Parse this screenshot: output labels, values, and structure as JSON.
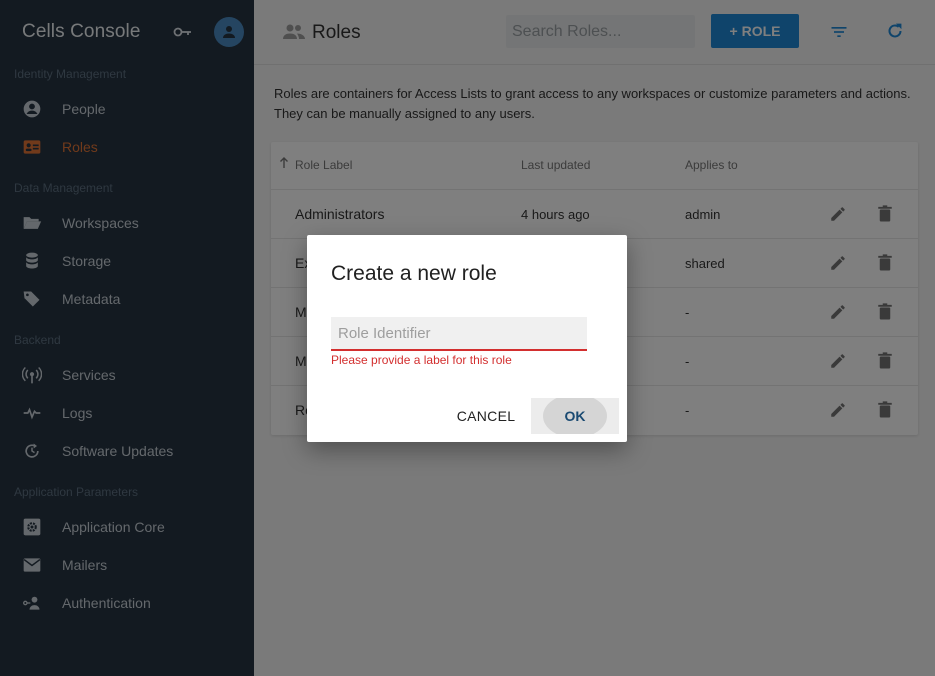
{
  "sidebar": {
    "title": "Cells Console",
    "sections": {
      "identity": "Identity Management",
      "data": "Data Management",
      "backend": "Backend",
      "app": "Application Parameters"
    },
    "items": {
      "people": "People",
      "roles": "Roles",
      "workspaces": "Workspaces",
      "storage": "Storage",
      "metadata": "Metadata",
      "services": "Services",
      "logs": "Logs",
      "updates": "Software Updates",
      "core": "Application Core",
      "mailers": "Mailers",
      "auth": "Authentication"
    },
    "active_color": "#e37537"
  },
  "header": {
    "title": "Roles",
    "search_placeholder": "Search Roles...",
    "add_button": "+ ROLE"
  },
  "description": "Roles are containers for Access Lists to grant access to any workspaces or customize parameters and actions. They can be manually assigned to any users.",
  "table": {
    "columns": {
      "label": "Role Label",
      "updated": "Last updated",
      "applies": "Applies to"
    },
    "rows": [
      {
        "label": "Administrators",
        "updated": "4 hours ago",
        "applies": "admin"
      },
      {
        "label": "Ex",
        "updated": "",
        "applies": "shared"
      },
      {
        "label": "M",
        "updated": "",
        "applies": "-"
      },
      {
        "label": "M",
        "updated": "",
        "applies": "-"
      },
      {
        "label": "Ro",
        "updated": "",
        "applies": "-"
      }
    ]
  },
  "dialog": {
    "title": "Create a new role",
    "input_placeholder": "Role Identifier",
    "error": "Please provide a label for this role",
    "cancel": "CANCEL",
    "ok": "OK"
  },
  "colors": {
    "primary": "#1e88d6",
    "error": "#d32f2f",
    "sidebar_bg": "#263442"
  }
}
